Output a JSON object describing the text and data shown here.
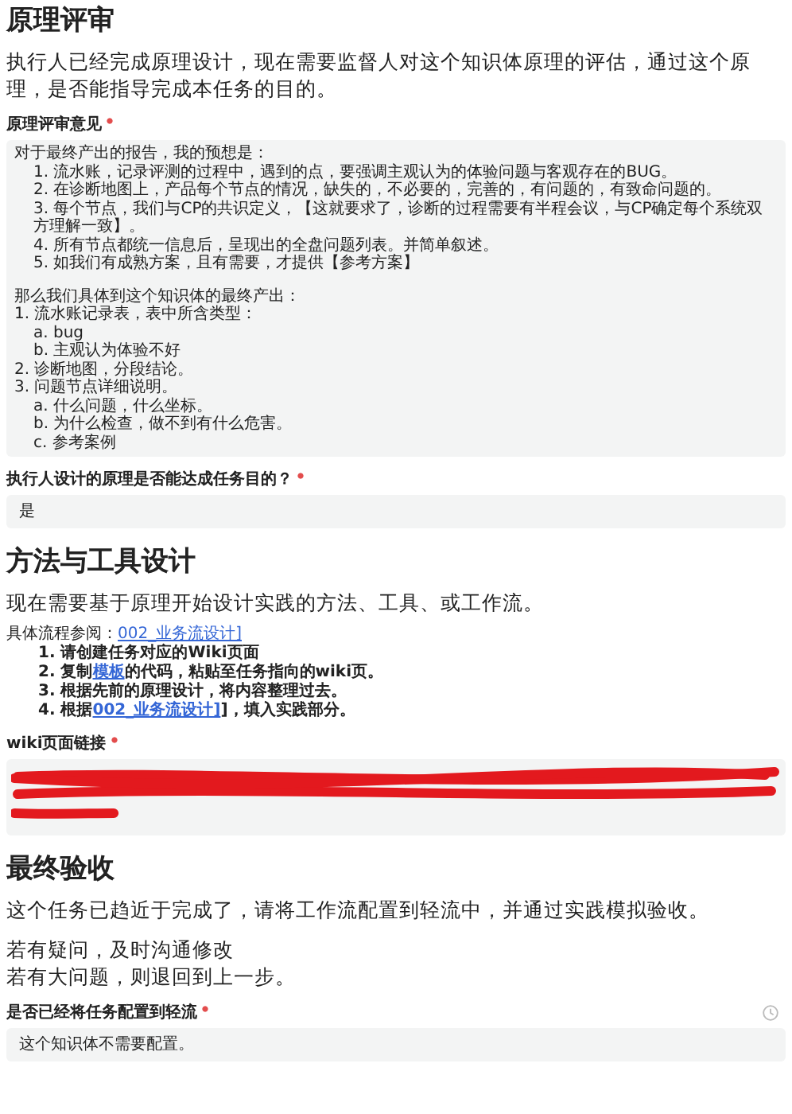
{
  "sections": [
    {
      "title": "原理评审",
      "description": [
        "执行人已经完成原理设计，现在需要监督人对这个知识体原理的评估，通过这个原理，是否能指导完成本任务的目的。"
      ],
      "fields": [
        {
          "kind": "outline",
          "label": "原理评审意见",
          "required": true,
          "paragraphs": [
            [
              {
                "text": "对于最终产出的报告，我的预想是：",
                "children": [
                  {
                    "text": "1. 流水账，记录评测的过程中，遇到的点，要强调主观认为的体验问题与客观存在的BUG。"
                  },
                  {
                    "text": "2. 在诊断地图上，产品每个节点的情况，缺失的，不必要的，完善的，有问题的，有致命问题的。"
                  },
                  {
                    "text": "3. 每个节点，我们与CP的共识定义，【这就要求了，诊断的过程需要有半程会议，与CP确定每个系统双方理解一致】。"
                  },
                  {
                    "text": "4. 所有节点都统一信息后，呈现出的全盘问题列表。并简单叙述。"
                  },
                  {
                    "text": "5. 如我们有成熟方案，且有需要，才提供【参考方案】"
                  }
                ]
              }
            ],
            [
              {
                "text": "那么我们具体到这个知识体的最终产出："
              },
              {
                "text": "1. 流水账记录表，表中所含类型：",
                "children": [
                  {
                    "text": "a. bug"
                  },
                  {
                    "text": "b. 主观认为体验不好"
                  }
                ]
              },
              {
                "text": "2. 诊断地图，分段结论。"
              },
              {
                "text": "3. 问题节点详细说明。",
                "children": [
                  {
                    "text": "a. 什么问题，什么坐标。"
                  },
                  {
                    "text": "b. 为什么检查，做不到有什么危害。"
                  },
                  {
                    "text": "c. 参考案例"
                  }
                ]
              }
            ]
          ]
        },
        {
          "kind": "text",
          "label": "执行人设计的原理是否能达成任务目的？",
          "required": true,
          "value": "是"
        }
      ]
    },
    {
      "title": "方法与工具设计",
      "description": [
        "现在需要基于原理开始设计实践的方法、工具、或工作流。"
      ],
      "guide": {
        "intro": [
          {
            "text": "具体流程参阅："
          },
          {
            "text": "002_业务流设计]",
            "link": true
          }
        ],
        "steps": [
          [
            {
              "text": "1. 请创建任务对应的Wiki页面"
            }
          ],
          [
            {
              "text": "2. 复制"
            },
            {
              "text": "模板",
              "link": true
            },
            {
              "text": "的代码，粘贴至任务指向的wiki页。"
            }
          ],
          [
            {
              "text": "3. 根据先前的原理设计，将内容整理过去。"
            }
          ],
          [
            {
              "text": "4. 根据"
            },
            {
              "text": "002_业务流设计]",
              "link": true
            },
            {
              "text": "]，填入实践部分。"
            }
          ]
        ]
      },
      "fields": [
        {
          "kind": "text",
          "label": "wiki页面链接",
          "required": true,
          "redacted": true
        }
      ]
    },
    {
      "title": "最终验收",
      "description": [
        "这个任务已趋近于完成了，请将工作流配置到轻流中，并通过实践模拟验收。",
        [
          "若有疑问，及时沟通修改",
          "若有大问题，则退回到上一步。"
        ]
      ],
      "fields": [
        {
          "kind": "text",
          "label": "是否已经将任务配置到轻流",
          "required": true,
          "value": "这个知识体不需要配置。",
          "history": true
        }
      ]
    }
  ]
}
